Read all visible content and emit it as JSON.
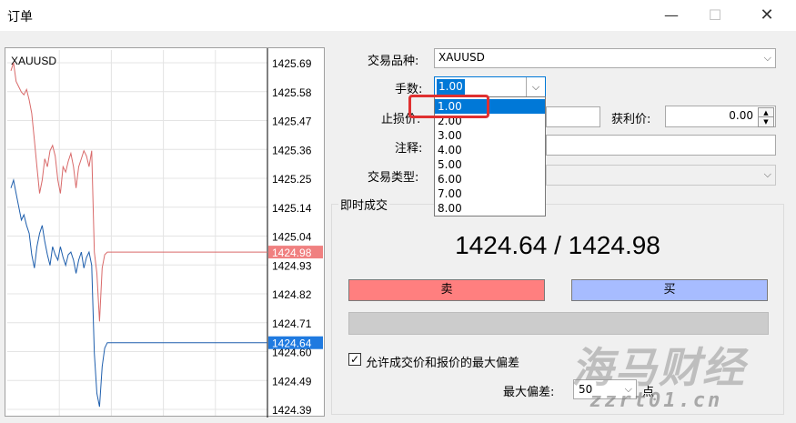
{
  "window": {
    "title": "订单",
    "min_icon": "minimize-icon",
    "max_icon": "maximize-icon",
    "close_icon": "close-icon"
  },
  "chart": {
    "symbol": "XAUUSD",
    "price_labels": [
      "1425.69",
      "1425.58",
      "1425.47",
      "1425.36",
      "1425.25",
      "1425.14",
      "1425.04",
      "1424.93",
      "1424.82",
      "1424.71",
      "1424.60",
      "1424.49",
      "1424.39"
    ],
    "ask_tag": "1424.98",
    "bid_tag": "1424.64",
    "ask_color": "#d96a6a",
    "bid_color": "#1f5fad",
    "ask_tag_color": "#f08080",
    "bid_tag_color": "#1f7ae0"
  },
  "chart_data": {
    "type": "line",
    "ylim": [
      1424.39,
      1425.69
    ],
    "grid": true,
    "series": [
      {
        "values": [
          1425.66,
          1425.69,
          1425.62,
          1425.6,
          1425.58,
          1425.57,
          1425.59,
          1425.55,
          1425.5,
          1425.4,
          1425.3,
          1425.2,
          1425.25,
          1425.33,
          1425.3,
          1425.36,
          1425.38,
          1425.34,
          1425.25,
          1425.2,
          1425.3,
          1425.28,
          1425.32,
          1425.35,
          1425.3,
          1425.22,
          1425.3,
          1425.33,
          1425.36,
          1425.34,
          1425.3,
          1425.36,
          1424.98,
          1424.9,
          1424.72,
          1424.92,
          1424.97,
          1424.98,
          1424.98,
          1424.98,
          1424.98,
          1424.98,
          1424.98,
          1424.98,
          1424.98,
          1424.98,
          1424.98
        ]
      },
      {
        "values": [
          1425.22,
          1425.25,
          1425.2,
          1425.15,
          1425.1,
          1425.12,
          1425.08,
          1425.05,
          1424.97,
          1424.92,
          1425.0,
          1425.05,
          1425.08,
          1425.02,
          1424.97,
          1424.93,
          1425.0,
          1424.97,
          1424.95,
          1425.0,
          1424.96,
          1424.93,
          1424.97,
          1424.98,
          1424.95,
          1424.9,
          1424.95,
          1424.98,
          1424.92,
          1424.96,
          1424.98,
          1424.93,
          1424.6,
          1424.45,
          1424.4,
          1424.55,
          1424.62,
          1424.64,
          1424.64,
          1424.64,
          1424.64,
          1424.64,
          1424.64,
          1424.64,
          1424.64,
          1424.64,
          1424.64
        ]
      }
    ]
  },
  "form": {
    "symbol_label": "交易品种:",
    "symbol_value": "XAUUSD",
    "lots_label": "手数:",
    "lots_value": "1.00",
    "lots_options": [
      "1.00",
      "2.00",
      "3.00",
      "4.00",
      "5.00",
      "6.00",
      "7.00",
      "8.00"
    ],
    "stoploss_label": "止损价:",
    "takeprofit_label": "获利价:",
    "takeprofit_value": "0.00",
    "comment_label": "注释:",
    "type_label": "交易类型:",
    "spin_up": "▲",
    "spin_down": "▼",
    "arrow": "⌵"
  },
  "instant": {
    "group_title": "即时成交",
    "price_text": "1424.64 / 1424.98",
    "sell_label": "卖",
    "buy_label": "买",
    "sell_color": "#ff7f7f",
    "buy_color": "#a7bcff",
    "allow_dev_label": "允许成交价和报价的最大偏差",
    "allow_dev_checked": "✓",
    "max_dev_label": "最大偏差:",
    "max_dev_value": "50",
    "points_label": "点"
  },
  "watermark": {
    "main": "海马财经",
    "url": "zzrt01.cn"
  }
}
